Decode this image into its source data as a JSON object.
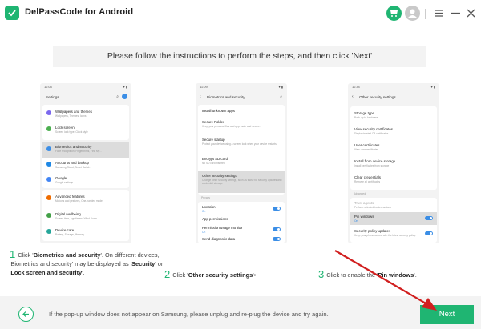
{
  "app": {
    "title": "DelPassCode for Android"
  },
  "titlebar": {
    "icons": [
      "cart-icon",
      "user-icon",
      "menu-icon",
      "minimize-icon",
      "close-icon"
    ]
  },
  "banner": {
    "text": "Please follow the instructions to perform the steps, and then click 'Next'"
  },
  "phone1": {
    "time": "11:08",
    "title": "Settings",
    "items": [
      {
        "label": "Wallpapers and themes",
        "sub": "Wallpapers, Themes, Icons",
        "color": "#7b68ee"
      },
      {
        "label": "Lock screen",
        "sub": "Screen lock type, Clock style",
        "color": "#4caf50"
      },
      {
        "label": "Biometrics and security",
        "sub": "Face recognition, Fingerprints, Find My...",
        "color": "#3b8ee6",
        "highlight": true
      },
      {
        "label": "Accounts and backup",
        "sub": "Samsung Cloud, Smart Switch",
        "color": "#1e88e5"
      },
      {
        "label": "Google",
        "sub": "Google settings",
        "color": "#4285f4"
      },
      {
        "label": "Advanced features",
        "sub": "Motions and gestures, One-handed mode",
        "color": "#ef6c00"
      },
      {
        "label": "Digital wellbeing",
        "sub": "Screen time, App timers, Wind Down",
        "color": "#43a047"
      },
      {
        "label": "Device care",
        "sub": "Battery, Storage, Memory",
        "color": "#26a69a"
      }
    ]
  },
  "phone2": {
    "time": "11:09",
    "title": "Biometrics and security",
    "items": [
      {
        "label": "Install unknown apps",
        "sub": ""
      },
      {
        "label": "Secure Folder",
        "sub": "Keep your personal files and apps safe and secure."
      },
      {
        "label": "Secure startup",
        "sub": "Protect your device using a screen lock when your device restarts."
      },
      {
        "label": "Encrypt SD card",
        "sub": "No SD card inserted"
      },
      {
        "label": "Other security settings",
        "sub": "Change other security settings, such as those for security updates and credential storage.",
        "highlight": true
      },
      {
        "label": "Location",
        "sub": "On",
        "toggle": true
      },
      {
        "label": "App permissions",
        "sub": ""
      },
      {
        "label": "Permission usage monitor",
        "sub": "On",
        "toggle": true
      },
      {
        "label": "Send diagnostic data",
        "sub": "",
        "toggle": true
      }
    ],
    "group_label": "Privacy"
  },
  "phone3": {
    "time": "11:34",
    "title": "Other security settings",
    "items": [
      {
        "label": "Storage type",
        "sub": "Back up to hardware"
      },
      {
        "label": "View security certificates",
        "sub": "Display trusted CA certificates."
      },
      {
        "label": "User certificates",
        "sub": "View user certificates"
      },
      {
        "label": "Install from device storage",
        "sub": "Install certificates from storage"
      },
      {
        "label": "Clear credentials",
        "sub": "Remove all certificates"
      },
      {
        "label": "Trust agents",
        "sub": "Perform selected trusted actions"
      },
      {
        "label": "Pin windows",
        "sub": "On",
        "toggle": true,
        "highlight": true
      },
      {
        "label": "Security policy updates",
        "sub": "Keep your phone secure with the latest security policy.",
        "toggle": true
      }
    ],
    "group_label": "Advanced"
  },
  "steps": {
    "s1_num": "1",
    "s1_a": "Click '",
    "s1_b": "Biometrics and security",
    "s1_c": "'. On different devices, 'Biometrics and security' may be displayed as '",
    "s1_d": "Security",
    "s1_e": "' or '",
    "s1_f": "Lock screen and security",
    "s1_g": "'.",
    "s2_num": "2",
    "s2_a": "Click '",
    "s2_b": "Other security settings",
    "s2_c": "'•",
    "s3_num": "3",
    "s3_a": "Click to enable the '",
    "s3_b": "Pin windows",
    "s3_c": "'."
  },
  "bottom": {
    "hint": "If the pop-up window does not appear on Samsung, please unplug and re-plug the device and try again.",
    "next_label": "Next"
  },
  "colors": {
    "accent": "#1fb572",
    "arrow": "#d11f1f"
  }
}
